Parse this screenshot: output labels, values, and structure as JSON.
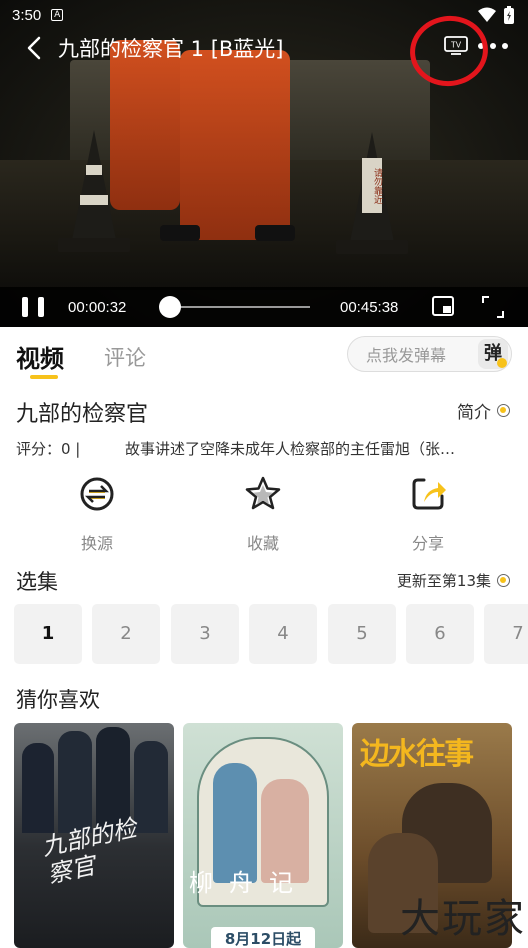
{
  "status_bar": {
    "time": "3:50",
    "app_glyph": "A"
  },
  "video": {
    "title": "九部的检察官 1 [B蓝光]",
    "tv_label": "TV",
    "cone_text": "请勿靠近",
    "current_time": "00:00:32",
    "total_time": "00:45:38",
    "progress_fraction": 0.0117
  },
  "tabs": {
    "active": "视频",
    "inactive": "评论"
  },
  "danmu": {
    "placeholder": "点我发弹幕",
    "button": "弹"
  },
  "show": {
    "title": "九部的检察官",
    "intro_label": "简介",
    "rating": "评分：0 |",
    "summary": "故事讲述了空降未成年人检察部的主任雷旭（张…"
  },
  "actions": [
    {
      "label": "换源",
      "icon": "switch-source-icon"
    },
    {
      "label": "收藏",
      "icon": "star-icon"
    },
    {
      "label": "分享",
      "icon": "share-icon"
    }
  ],
  "episodes": {
    "header": "选集",
    "update": "更新至第13集",
    "items": [
      "1",
      "2",
      "3",
      "4",
      "5",
      "6",
      "7"
    ],
    "active": "1"
  },
  "recommend": {
    "header": "猜你喜欢",
    "posters": [
      {
        "title_art": "九部的检察官",
        "icon": "poster-icon"
      },
      {
        "title_art": "柳舟记",
        "banner": "8月12日起",
        "icon": "poster-icon"
      },
      {
        "title_art": "边水往事",
        "icon": "poster-icon"
      }
    ]
  },
  "watermark": "大玩家",
  "colors": {
    "accent": "#f7c21b",
    "annotation": "#e3151c"
  }
}
